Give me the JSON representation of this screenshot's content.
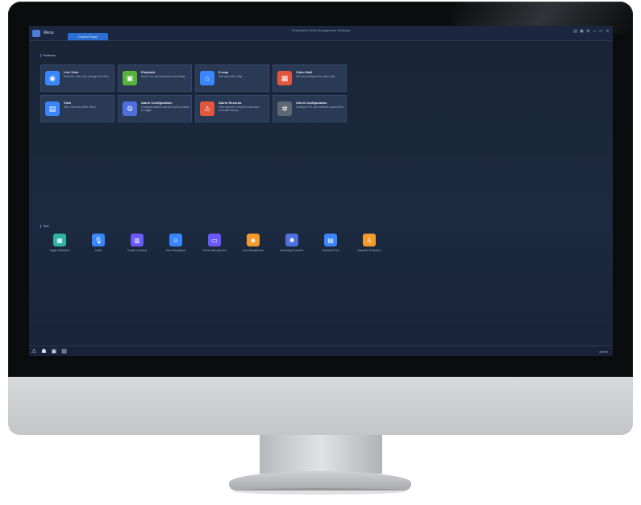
{
  "window": {
    "title": "Centralized Video Management Software",
    "menu_label": "Menu",
    "active_tab": "Control Panel",
    "controls": [
      "▤",
      "▣",
      "⚙",
      "—",
      "▭",
      "✕"
    ]
  },
  "sections": {
    "features_label": "Features",
    "tools_label": "Tool"
  },
  "features": [
    {
      "title": "Live View",
      "desc": "View live video and manage the view.",
      "color": "#3a86ff",
      "icon": "live-view-icon",
      "glyph": "◉"
    },
    {
      "title": "Playback",
      "desc": "Search for and play back recordings.",
      "color": "#57b33a",
      "icon": "playback-icon",
      "glyph": "▣"
    },
    {
      "title": "E-map",
      "desc": "Add and edit a map.",
      "color": "#3a86ff",
      "icon": "emap-icon",
      "glyph": "⌂"
    },
    {
      "title": "Video Wall",
      "desc": "Set and configure the video wall.",
      "color": "#e3563d",
      "icon": "video-wall-icon",
      "glyph": "▦"
    },
    {
      "title": "View",
      "desc": "Add, edit and delete views.",
      "color": "#3a86ff",
      "icon": "view-icon",
      "glyph": "▤"
    },
    {
      "title": "Alarm Configuration",
      "desc": "Configure alarms and set up the actions to trigger.",
      "color": "#4f6fe0",
      "icon": "alarm-config-icon",
      "glyph": "⚙"
    },
    {
      "title": "Alarm Records",
      "desc": "View alarms in real time and view recorded history.",
      "color": "#e3563d",
      "icon": "alarm-records-icon",
      "glyph": "⚠"
    },
    {
      "title": "Client Configuration",
      "desc": "Configure PC and software parameters.",
      "color": "#5f6775",
      "icon": "client-config-icon",
      "glyph": "✲"
    }
  ],
  "tools": [
    {
      "label": "Target Verification",
      "color": "#2fb3a0",
      "icon": "target-verification-icon",
      "glyph": "▦"
    },
    {
      "label": "Audio",
      "color": "#3a86ff",
      "icon": "audio-icon",
      "glyph": "🎙"
    },
    {
      "label": "People Counting",
      "color": "#6a5af9",
      "icon": "people-counting-icon",
      "glyph": "▥"
    },
    {
      "label": "Face Recognition",
      "color": "#3a86ff",
      "icon": "face-recognition-icon",
      "glyph": "☺"
    },
    {
      "label": "Device Management",
      "color": "#6a5af9",
      "icon": "device-management-icon",
      "glyph": "▭"
    },
    {
      "label": "User Management",
      "color": "#f39a2c",
      "icon": "user-management-icon",
      "glyph": "☻"
    },
    {
      "label": "Recording Schedule",
      "color": "#4f6fe0",
      "icon": "recording-schedule-icon",
      "glyph": "✺"
    },
    {
      "label": "Download Tool",
      "color": "#3a86ff",
      "icon": "download-icon",
      "glyph": "▤"
    },
    {
      "label": "Operation Protection",
      "color": "#f39a2c",
      "icon": "operation-protection-icon",
      "glyph": "♙"
    }
  ],
  "statusbar": {
    "icons": [
      "⚠",
      "☗",
      "▣",
      "▤"
    ],
    "right_text": "admin"
  }
}
